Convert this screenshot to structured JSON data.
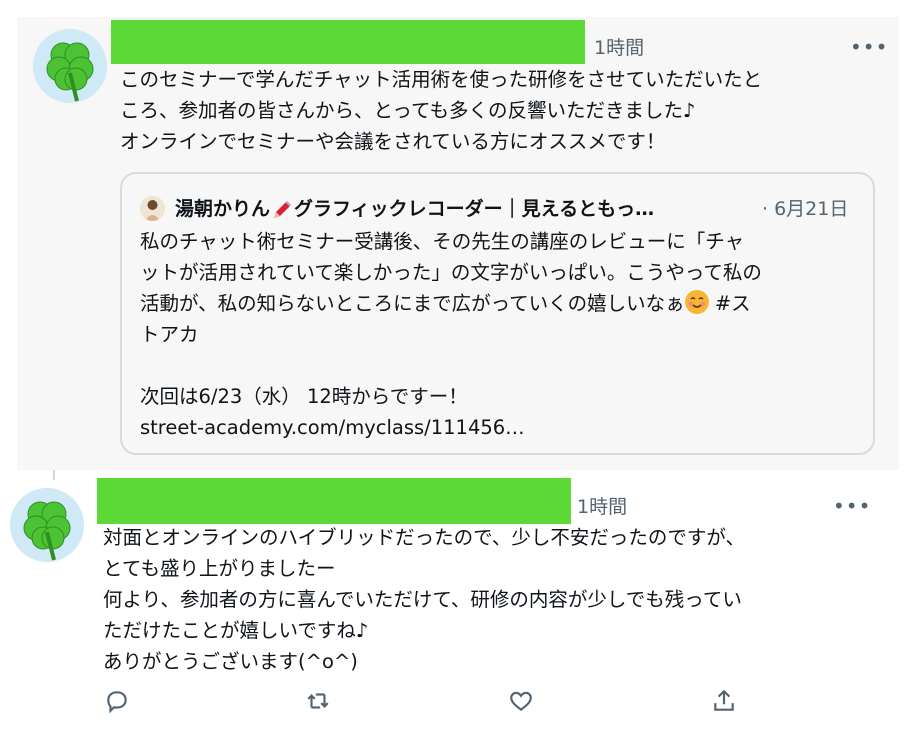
{
  "tweet1": {
    "time": "1時間",
    "more": "•••",
    "text": "このセミナーで学んだチャット活用術を使った研修をさせていただいたと\nころ、参加者の皆さんから、とっても多くの反響いただきました♪\nオンラインでセミナーや会議をされている方にオススメです！",
    "quote": {
      "author_prefix": "湯朝かりん",
      "author_suffix": "グラフィックレコーダー｜見えるともっ…",
      "date": "· 6月21日",
      "text_part1": "私のチャット術セミナー受講後、その先生の講座のレビューに「チャ\nットが活用されていて楽しかった」の文字がいっぱい。こうやって私の\n活動が、私の知らないところにまで広がっていくの嬉しいなぁ",
      "text_part2": " #ス\nトアカ\n\n次回は6/23（水） 12時からですー！\nstreet-academy.com/myclass/111456…"
    }
  },
  "tweet2": {
    "time": "1時間",
    "more": "•••",
    "text": "対面とオンラインのハイブリッドだったので、少し不安だったのですが、\nとても盛り上がりましたー\n何より、参加者の方に喜んでいただけて、研修の内容が少しでも残ってい\nただけたことが嬉しいですね♪\nありがとうございます(^o^)"
  },
  "actions": [
    "reply-icon",
    "retweet-icon",
    "like-icon",
    "share-icon"
  ],
  "colors": {
    "redaction": "#5dd937",
    "muted": "#536471",
    "highlight_bg": "#f7f7f7"
  }
}
